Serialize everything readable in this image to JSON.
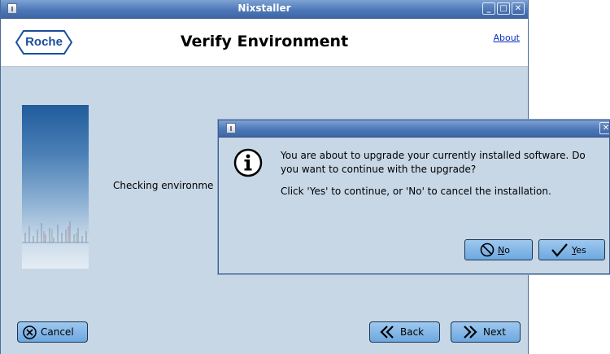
{
  "main_window": {
    "title": "Nixstaller",
    "window_buttons": [
      "minimize-icon",
      "maximize-icon",
      "close-icon"
    ],
    "header": {
      "logo_text": "Roche",
      "page_title": "Verify Environment",
      "about_link": "About"
    },
    "status_text": "Checking environme",
    "footer": {
      "cancel_label": "Cancel",
      "back_label": "Back",
      "next_label": "Next"
    }
  },
  "dialog": {
    "title": "",
    "icon": "info-icon",
    "message_line1": "You are about to upgrade your currently installed software. Do you want to continue with the upgrade?",
    "message_line2": "Click 'Yes' to continue, or 'No' to cancel the installation.",
    "no_label_mnemonic": "N",
    "no_label_rest": "o",
    "yes_label_mnemonic": "Y",
    "yes_label_rest": "es"
  },
  "colors": {
    "window_bg": "#c7d7e6",
    "titlebar": "#4d78b8",
    "button": "#7fb4e6",
    "brand": "#1a4d9c",
    "link": "#0a2fc9"
  }
}
